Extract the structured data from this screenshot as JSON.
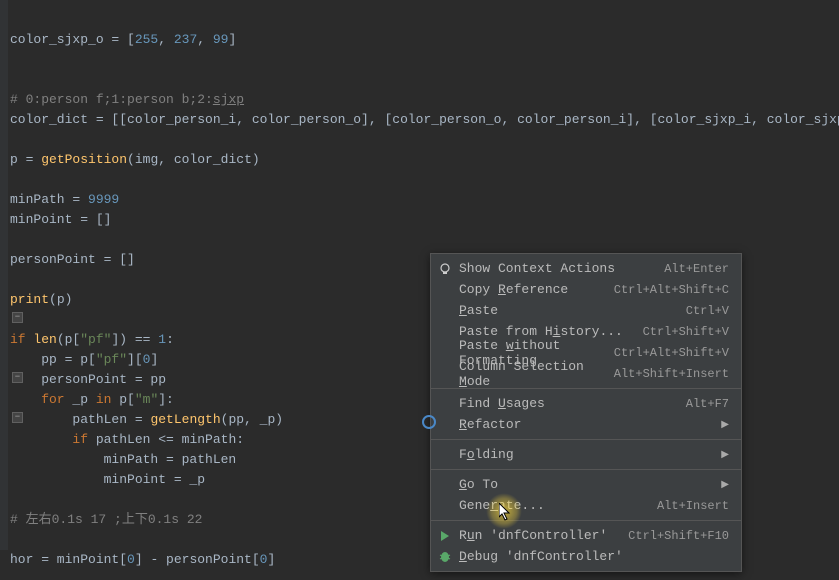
{
  "code": {
    "line1_a": "color_sjxp_o = [",
    "line1_n1": "255",
    "line1_c1": ", ",
    "line1_n2": "237",
    "line1_c2": ", ",
    "line1_n3": "99",
    "line1_b": "]",
    "line3": "# 0:person f;1:person b;2:",
    "line3_u": "sjxp",
    "line4": "color_dict = [[color_person_i, color_person_o], [color_person_o, color_person_i], [color_sjxp_i, color_sjxp_o]]",
    "line6_a": "p = ",
    "line6_f": "getPosition",
    "line6_b": "(img, color_dict)",
    "line8_a": "minPath = ",
    "line8_n": "9999",
    "line9": "minPoint = []",
    "line11": "personPoint = []",
    "line13_f": "print",
    "line13_b": "(p)",
    "line15_k1": "if ",
    "line15_f": "len",
    "line15_a": "(p[",
    "line15_s": "\"pf\"",
    "line15_b": "]) == ",
    "line15_n": "1",
    "line15_c": ":",
    "line16_a": "    pp = p[",
    "line16_s": "\"pf\"",
    "line16_b": "][",
    "line16_n": "0",
    "line16_c": "]",
    "line17": "    personPoint = pp",
    "line18_k1": "    for ",
    "line18_a": "_p ",
    "line18_k2": "in ",
    "line18_b": "p[",
    "line18_s": "\"m\"",
    "line18_c": "]:",
    "line19_a": "        pathLen = ",
    "line19_f": "getLength",
    "line19_b": "(pp, _p)",
    "line20_k": "        if ",
    "line20_a": "pathLen <= minPath:",
    "line21": "            minPath = pathLen",
    "line22": "            minPoint = _p",
    "line24": "# 左右0.1s 17 ;上下0.1s 22",
    "line26_a": "hor = minPoint[",
    "line26_n1": "0",
    "line26_b": "] - personPoint[",
    "line26_n2": "0",
    "line26_c": "]"
  },
  "menu": {
    "items": [
      {
        "icon": "bulb",
        "label_parts": [
          "Show Context Actions"
        ],
        "shortcut": "Alt+Enter"
      },
      {
        "label_parts": [
          "Copy ",
          "R",
          "eference"
        ],
        "u": 1,
        "shortcut": "Ctrl+Alt+Shift+C"
      },
      {
        "label_parts": [
          "",
          "P",
          "aste"
        ],
        "u": 1,
        "shortcut": "Ctrl+V"
      },
      {
        "label_parts": [
          "Paste from H",
          "i",
          "story..."
        ],
        "u": 1,
        "shortcut": "Ctrl+Shift+V"
      },
      {
        "label_parts": [
          "Paste ",
          "w",
          "ithout Formatting"
        ],
        "u": 1,
        "shortcut": "Ctrl+Alt+Shift+V"
      },
      {
        "label_parts": [
          "Column Selection ",
          "M",
          "ode"
        ],
        "u": 1,
        "shortcut": "Alt+Shift+Insert"
      },
      {
        "sep": true
      },
      {
        "label_parts": [
          "Find ",
          "U",
          "sages"
        ],
        "u": 1,
        "shortcut": "Alt+F7"
      },
      {
        "label_parts": [
          "",
          "R",
          "efactor"
        ],
        "u": 1,
        "submenu": true
      },
      {
        "sep": true
      },
      {
        "label_parts": [
          "F",
          "o",
          "lding"
        ],
        "u": 1,
        "submenu": true
      },
      {
        "sep": true
      },
      {
        "label_parts": [
          "",
          "G",
          "o To"
        ],
        "u": 1,
        "submenu": true
      },
      {
        "label_parts": [
          "Gene",
          "r",
          "ate..."
        ],
        "u": 1,
        "shortcut": "Alt+Insert"
      },
      {
        "sep": true
      },
      {
        "icon": "run",
        "label_parts": [
          "R",
          "u",
          "n 'dnfController'"
        ],
        "u": 1,
        "shortcut": "Ctrl+Shift+F10"
      },
      {
        "icon": "debug",
        "label_parts": [
          "",
          "D",
          "ebug 'dnfController'"
        ],
        "u": 1
      }
    ]
  }
}
